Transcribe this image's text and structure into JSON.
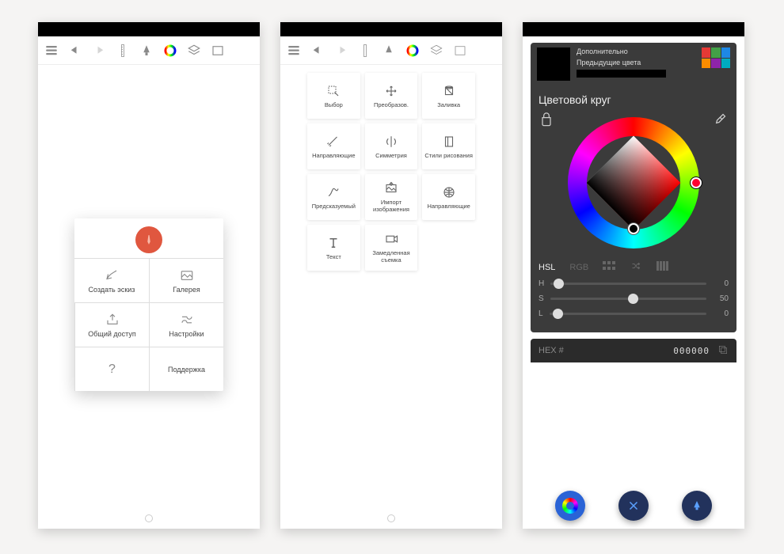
{
  "toolbar_icons": [
    "menu",
    "undo",
    "redo",
    "ruler",
    "brush",
    "color",
    "layers",
    "fullscreen"
  ],
  "panelA": {
    "menu": {
      "sketch": "Создать эскиз",
      "gallery": "Галерея",
      "share": "Общий доступ",
      "settings": "Настройки",
      "help_icon": "?",
      "support": "Поддержка"
    }
  },
  "panelB": {
    "tools": [
      "Выбор",
      "Преобразов.",
      "Заливка",
      "Направляющие",
      "Симметрия",
      "Стили рисования",
      "Предсказуемый",
      "Импорт изображения",
      "Направляющие",
      "Текст",
      "Замедленная съемка"
    ]
  },
  "panelC": {
    "header": {
      "extra": "Дополнительно",
      "prev": "Предыдущие цвета"
    },
    "title": "Цветовой круг",
    "tabs": {
      "hsl": "HSL",
      "rgb": "RGB"
    },
    "sliders": [
      {
        "name": "H",
        "value": 0,
        "pos": 2
      },
      {
        "name": "S",
        "value": 50,
        "pos": 50
      },
      {
        "name": "L",
        "value": 0,
        "pos": 2
      }
    ],
    "hex_label": "HEX #",
    "hex_value": "000000",
    "palette": [
      "#e53935",
      "#43a047",
      "#1e88e5",
      "#fb8c00",
      "#8e24aa",
      "#00acc1"
    ]
  }
}
